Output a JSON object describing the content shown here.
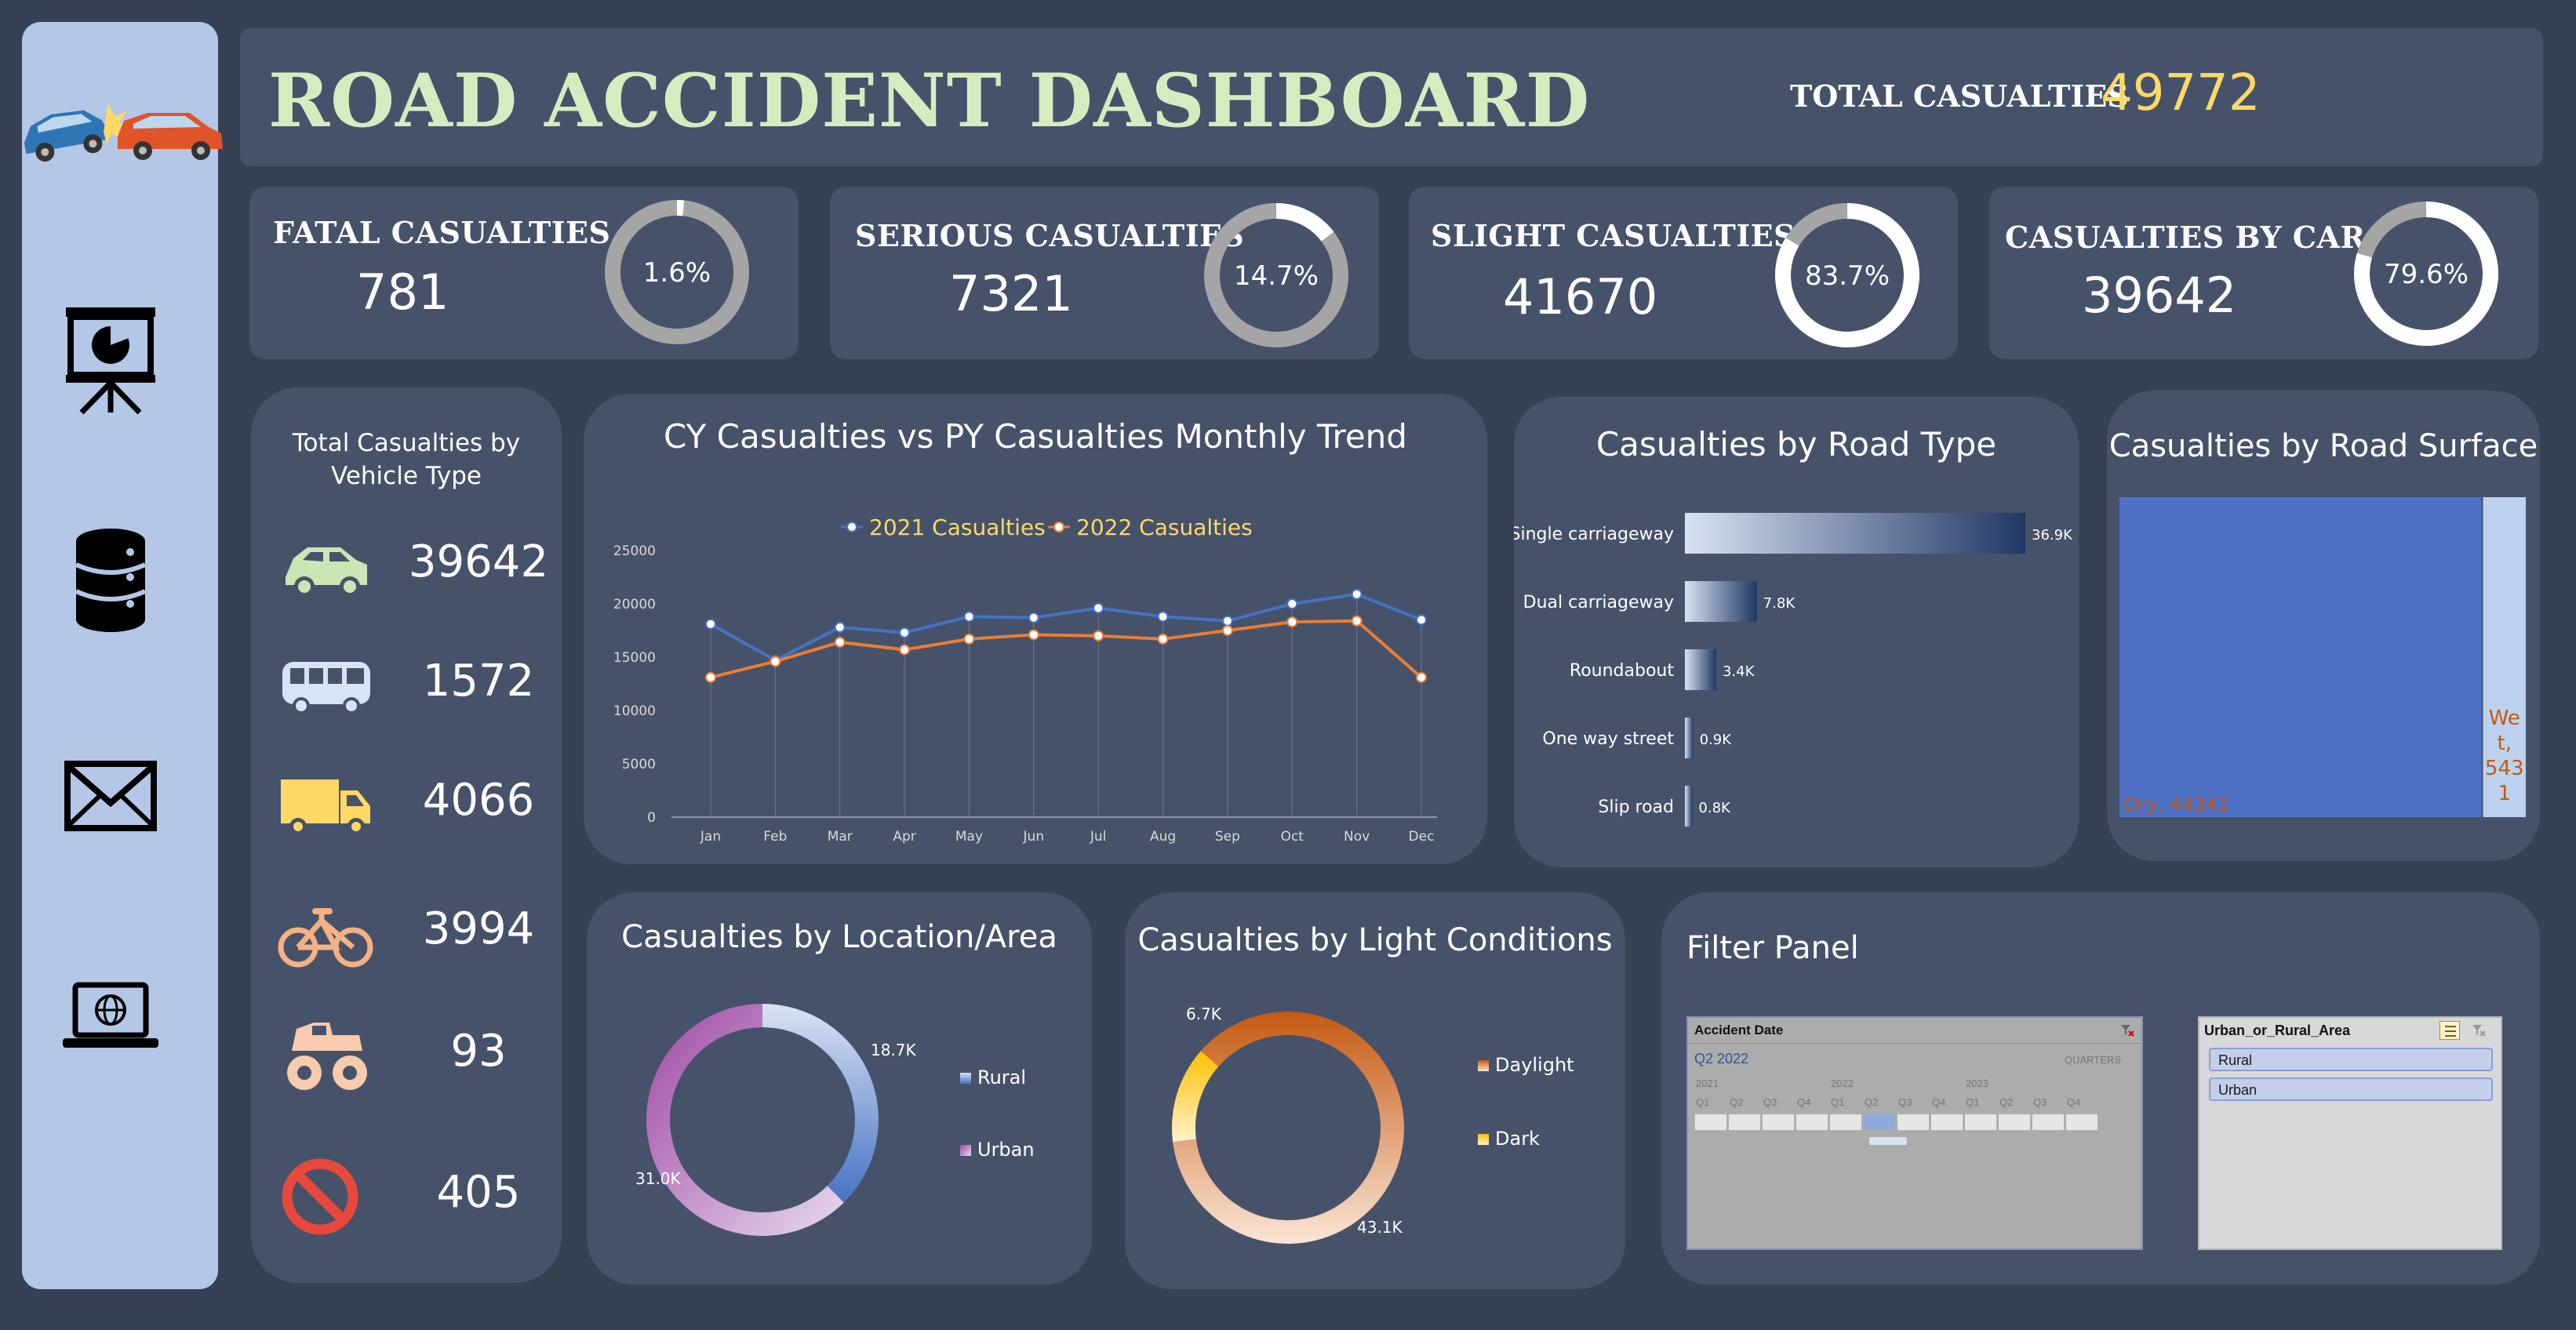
{
  "header": {
    "title": "ROAD ACCIDENT DASHBOARD",
    "total_label": "TOTAL CASUALTIES",
    "total_value": "49772"
  },
  "sidebar": {
    "icons": [
      "presentation-icon",
      "database-icon",
      "mail-icon",
      "laptop-globe-icon"
    ]
  },
  "kpis": [
    {
      "label": "FATAL CASUALTIES",
      "value": "781",
      "pct_text": "1.6%",
      "pct": 1.6
    },
    {
      "label": "SERIOUS CASUALTIES",
      "value": "7321",
      "pct_text": "14.7%",
      "pct": 14.7
    },
    {
      "label": "SLIGHT CASUALTIES",
      "value": "41670",
      "pct_text": "83.7%",
      "pct": 83.7
    },
    {
      "label": "CASUALTIES BY CAR",
      "value": "39642",
      "pct_text": "79.6%",
      "pct": 79.6
    }
  ],
  "vehicle": {
    "title_line1": "Total Casualties by",
    "title_line2": "Vehicle Type",
    "items": [
      {
        "icon": "car-icon",
        "value": "39642"
      },
      {
        "icon": "bus-icon",
        "value": "1572"
      },
      {
        "icon": "truck-icon",
        "value": "4066"
      },
      {
        "icon": "bicycle-icon",
        "value": "3994"
      },
      {
        "icon": "monster-truck-icon",
        "value": "93"
      },
      {
        "icon": "no-entry-icon",
        "value": "405"
      }
    ]
  },
  "trend": {
    "title": "CY Casualties vs PY Casualties Monthly Trend"
  },
  "road_type": {
    "title": "Casualties by Road Type"
  },
  "road_surface": {
    "title": "Casualties by Road Surface"
  },
  "location": {
    "title": "Casualties by Location/Area"
  },
  "light": {
    "title": "Casualties by Light Conditions"
  },
  "filter": {
    "title": "Filter Panel",
    "date_slicer": {
      "header": "Accident Date",
      "selection": "Q2 2022",
      "level": "QUARTERS",
      "years": [
        "2021",
        "2022",
        "2023"
      ],
      "quarters": [
        "Q1",
        "Q2",
        "Q3",
        "Q4",
        "Q1",
        "Q2",
        "Q3",
        "Q4",
        "Q1",
        "Q2",
        "Q3",
        "Q4"
      ],
      "selected_index": 5
    },
    "area_slicer": {
      "header": "Urban_or_Rural_Area",
      "options": [
        "Rural",
        "Urban"
      ]
    }
  },
  "colors": {
    "background": "#364154",
    "panel": "#46526a",
    "title_green": "#d6ecc0",
    "total_yellow": "#ffd966",
    "series_2021": "#4472c4",
    "series_2022": "#ed7d31",
    "rural": "#4472c4",
    "urban": "#9e48a4",
    "daylight": "#c55a11",
    "dark": "#ffd966"
  },
  "chart_data": [
    {
      "type": "line",
      "x": [
        "Jan",
        "Feb",
        "Mar",
        "Apr",
        "May",
        "Jun",
        "Jul",
        "Aug",
        "Sep",
        "Oct",
        "Nov",
        "Dec"
      ],
      "series": [
        {
          "name": "2021 Casualties",
          "values": [
            18100,
            14700,
            17800,
            17300,
            18800,
            18700,
            19600,
            18800,
            18400,
            20000,
            20900,
            18500
          ]
        },
        {
          "name": "2022 Casualties",
          "values": [
            13100,
            14600,
            16400,
            15700,
            16700,
            17100,
            17000,
            16700,
            17500,
            18300,
            18400,
            13100
          ]
        }
      ],
      "ylim": [
        0,
        25000
      ],
      "yticks": [
        0,
        5000,
        10000,
        15000,
        20000,
        25000
      ],
      "grid": false,
      "legend": "top"
    },
    {
      "type": "bar",
      "categories": [
        "Single carriageway",
        "Dual carriageway",
        "Roundabout",
        "One way street",
        "Slip road"
      ],
      "values": [
        36.9,
        7.8,
        3.4,
        0.9,
        0.8
      ],
      "labels": [
        "36.9K",
        "7.8K",
        "3.4K",
        "0.9K",
        "0.8K"
      ]
    },
    {
      "type": "treemap",
      "categories": [
        "Dry",
        "Wet"
      ],
      "values": [
        44341,
        5431
      ],
      "labels": [
        "Dry, 44341",
        "We t, 543 1"
      ]
    },
    {
      "type": "pie",
      "categories": [
        "Rural",
        "Urban"
      ],
      "values": [
        18.7,
        31.0
      ],
      "labels": [
        "18.7K",
        "31.0K"
      ],
      "legend": "right"
    },
    {
      "type": "pie",
      "categories": [
        "Daylight",
        "Dark"
      ],
      "values": [
        43.1,
        6.7
      ],
      "labels": [
        "43.1K",
        "6.7K"
      ],
      "legend": "right"
    }
  ]
}
